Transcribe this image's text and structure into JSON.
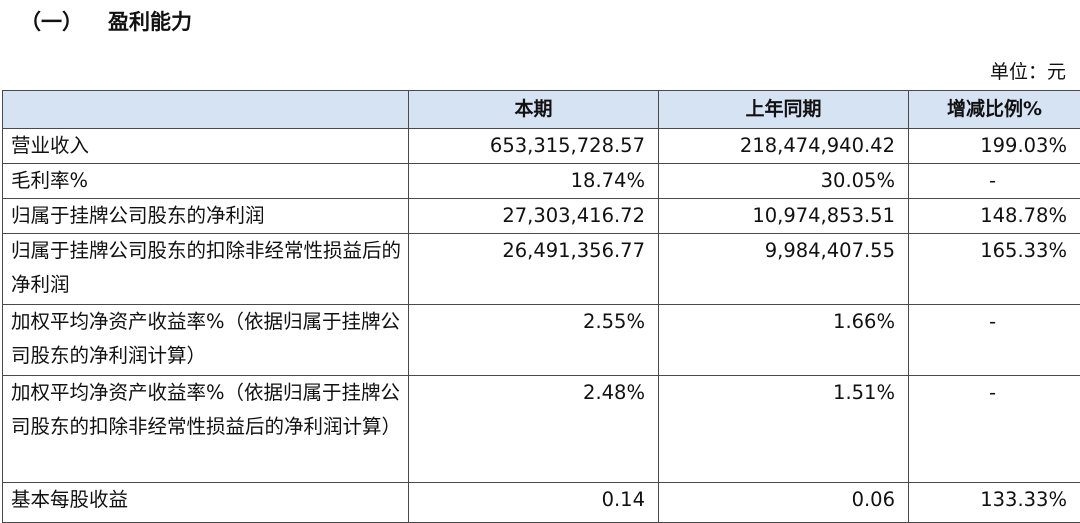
{
  "section": {
    "number": "（一）",
    "title": "盈利能力"
  },
  "unit_label": "单位：元",
  "table": {
    "headers": [
      "",
      "本期",
      "上年同期",
      "增减比例%"
    ],
    "rows": [
      {
        "label": "营业收入",
        "current": "653,315,728.57",
        "previous": "218,474,940.42",
        "change": "199.03%"
      },
      {
        "label": "毛利率%",
        "current": "18.74%",
        "previous": "30.05%",
        "change": "-"
      },
      {
        "label": "归属于挂牌公司股东的净利润",
        "current": "27,303,416.72",
        "previous": "10,974,853.51",
        "change": "148.78%"
      },
      {
        "label": "归属于挂牌公司股东的扣除非经常性损益后的净利润",
        "current": "26,491,356.77",
        "previous": "9,984,407.55",
        "change": "165.33%"
      },
      {
        "label": "加权平均净资产收益率%（依据归属于挂牌公司股东的净利润计算）",
        "current": "2.55%",
        "previous": "1.66%",
        "change": "-"
      },
      {
        "label": "加权平均净资产收益率%（依据归属于挂牌公司股东的扣除非经常性损益后的净利润计算）",
        "current": "2.48%",
        "previous": "1.51%",
        "change": "-"
      },
      {
        "label": "基本每股收益",
        "current": "0.14",
        "previous": "0.06",
        "change": "133.33%"
      }
    ]
  }
}
